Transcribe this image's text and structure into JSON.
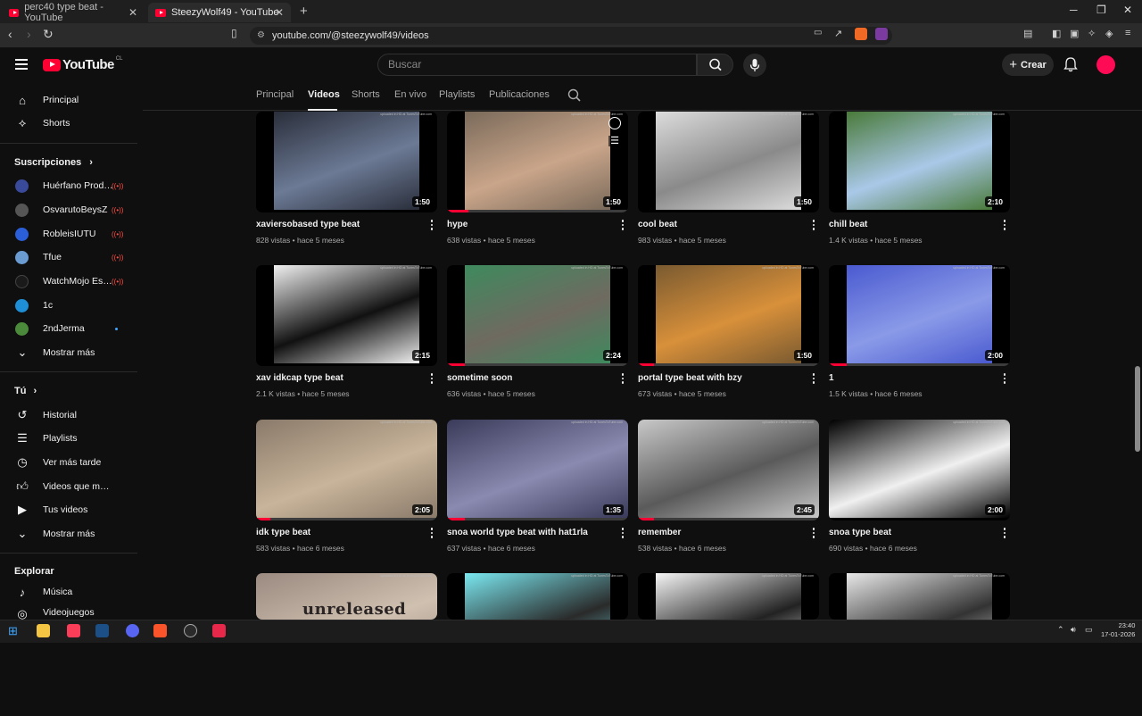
{
  "browser": {
    "tabs": [
      {
        "title": "perc40 type beat - YouTube",
        "active": false
      },
      {
        "title": "SteezyWolf49 - YouTube",
        "active": true
      }
    ],
    "url": "youtube.com/@steezywolf49/videos"
  },
  "header": {
    "logo_text": "YouTube",
    "logo_region": "CL",
    "search_placeholder": "Buscar",
    "create_label": "Crear"
  },
  "sidebar": {
    "main": [
      {
        "label": "Principal",
        "icon": "home-icon"
      },
      {
        "label": "Shorts",
        "icon": "shorts-icon"
      }
    ],
    "subscriptions_heading": "Suscripciones",
    "subscriptions": [
      {
        "label": "Huérfano Produc...",
        "live": true,
        "color": "#3a4a9a"
      },
      {
        "label": "OsvarutoBeysZ",
        "live": true,
        "color": "#555555"
      },
      {
        "label": "RobleisIUTU",
        "live": true,
        "color": "#2b5fd9"
      },
      {
        "label": "Tfue",
        "live": true,
        "color": "#6a9bd1"
      },
      {
        "label": "WatchMojo Espa...",
        "live": true,
        "color": "#1a1a1a"
      },
      {
        "label": "1c",
        "live": false,
        "color": "#1e8fd6"
      },
      {
        "label": "2ndJerma",
        "live": false,
        "new": true,
        "color": "#4a8a3a"
      }
    ],
    "show_more_1": "Mostrar más",
    "you_heading": "Tú",
    "you": [
      {
        "label": "Historial",
        "icon": "history-icon"
      },
      {
        "label": "Playlists",
        "icon": "playlists-icon"
      },
      {
        "label": "Ver más tarde",
        "icon": "watch-later-icon"
      },
      {
        "label": "Videos que me gus...",
        "icon": "thumbs-up-icon"
      },
      {
        "label": "Tus videos",
        "icon": "your-videos-icon"
      }
    ],
    "show_more_2": "Mostrar más",
    "explore_heading": "Explorar",
    "explore": [
      {
        "label": "Música",
        "icon": "music-icon"
      },
      {
        "label": "Videojuegos",
        "icon": "gaming-icon"
      }
    ]
  },
  "channel_tabs": [
    {
      "label": "Principal"
    },
    {
      "label": "Videos",
      "active": true
    },
    {
      "label": "Shorts"
    },
    {
      "label": "En vivo"
    },
    {
      "label": "Playlists"
    },
    {
      "label": "Publicaciones"
    }
  ],
  "watermark": "uploaded in HD at TunesToTube.com",
  "videos": [
    {
      "title": "xaviersobased type beat",
      "meta": "828 vistas • hace 5 meses",
      "duration": "1:50",
      "bg": "#2a2e3a",
      "accent": "#6c7a95",
      "progress": 0
    },
    {
      "title": "hype",
      "meta": "638 vistas • hace 5 meses",
      "duration": "1:50",
      "bg": "#7a6a5a",
      "accent": "#c9a58a",
      "progress": 0.12
    },
    {
      "title": "cool beat",
      "meta": "983 vistas • hace 5 meses",
      "duration": "1:50",
      "bg": "#dcdcdc",
      "accent": "#8a8a8a",
      "progress": 0
    },
    {
      "title": "chill beat",
      "meta": "1.4 K vistas • hace 5 meses",
      "duration": "2:10",
      "bg": "#4a7a3a",
      "accent": "#a9c8e8",
      "progress": 0
    },
    {
      "title": "xav idkcap type beat",
      "meta": "2.1 K vistas • hace 5 meses",
      "duration": "2:15",
      "bg": "#f0f0f0",
      "accent": "#111111",
      "progress": 0
    },
    {
      "title": "sometime soon",
      "meta": "636 vistas • hace 5 meses",
      "duration": "2:24",
      "bg": "#3e8a5e",
      "accent": "#6f6a60",
      "progress": 0.1
    },
    {
      "title": "portal type beat with bzy",
      "meta": "673 vistas • hace 5 meses",
      "duration": "1:50",
      "bg": "#7a5a30",
      "accent": "#d8903a",
      "progress": 0.09
    },
    {
      "title": "1",
      "meta": "1.5 K vistas • hace 6 meses",
      "duration": "2:00",
      "bg": "#4a5ad0",
      "accent": "#8a9ae8",
      "progress": 0.1
    },
    {
      "title": "idk type beat",
      "meta": "583 vistas • hace 6 meses",
      "duration": "2:05",
      "bg": "#8a7a6a",
      "accent": "#c8b49a",
      "progress": 0.08
    },
    {
      "title": "snoa world type beat with hat1rla",
      "meta": "637 vistas • hace 6 meses",
      "duration": "1:35",
      "bg": "#3a3a5a",
      "accent": "#8a8ab0",
      "progress": 0.1
    },
    {
      "title": "remember",
      "meta": "538 vistas • hace 6 meses",
      "duration": "2:45",
      "bg": "#c8c8c8",
      "accent": "#5a5a5a",
      "progress": 0.09
    },
    {
      "title": "snoa type beat",
      "meta": "690 vistas • hace 6 meses",
      "duration": "2:00",
      "bg": "#000000",
      "accent": "#f0f0f0",
      "progress": 0
    },
    {
      "title": "",
      "meta": "",
      "duration": "",
      "bg": "#9a8a80",
      "accent": "#d0c0b0",
      "progress": 0,
      "overlay_text": "unreleased"
    },
    {
      "title": "",
      "meta": "",
      "duration": "",
      "bg": "#7ae8f0",
      "accent": "#2a2a2a",
      "progress": 0
    },
    {
      "title": "",
      "meta": "",
      "duration": "",
      "bg": "#f5f5f5",
      "accent": "#222222",
      "progress": 0
    },
    {
      "title": "",
      "meta": "",
      "duration": "",
      "bg": "#e8e8e8",
      "accent": "#333333",
      "progress": 0
    }
  ],
  "taskbar": {
    "time": "23:40",
    "date": "17-01-2026"
  }
}
